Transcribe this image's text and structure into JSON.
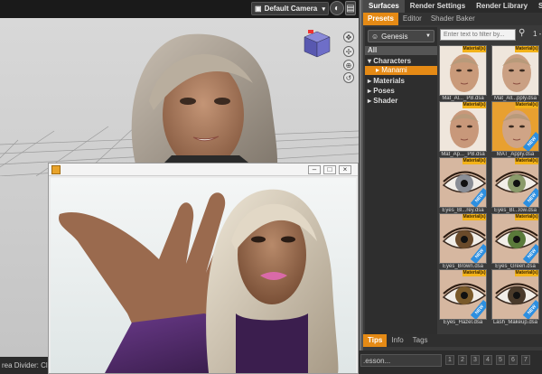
{
  "viewport": {
    "camera_label": "Default Camera"
  },
  "statusbar": {
    "text": "rea Divider: Click and drag to resize"
  },
  "lesson": {
    "select_text": ".esson...",
    "numbers": [
      "1",
      "2",
      "3",
      "4",
      "5",
      "6",
      "7"
    ]
  },
  "panel": {
    "tabs": [
      "Surfaces",
      "Render Settings",
      "Render Library",
      "Scene"
    ],
    "sub_tabs": [
      "Presets",
      "Editor",
      "Shader Baker"
    ],
    "figure_select": "Genesis",
    "tree": {
      "all": "All",
      "characters": "Characters",
      "manami": "Manami",
      "materials": "Materials",
      "poses": "Poses",
      "shader": "Shader"
    },
    "search_placeholder": "Enter text to filter by...",
    "pager": "1 -",
    "thumbs": [
      {
        "label": "Mat_Al..._PB.dsa",
        "tag": "Material(s)"
      },
      {
        "label": "Mat_All...pply.dsa",
        "tag": "Material(s)"
      },
      {
        "label": "Mat_Ap..._PB.dsa",
        "tag": "Material(s)"
      },
      {
        "label": "MAT_Apply.dsa",
        "tag": "Material(s)",
        "new": "NEW"
      },
      {
        "label": "Eyes_Bl...rey.dsa",
        "tag": "Material(s)",
        "new": "NEW"
      },
      {
        "label": "Eyes_Bl...low.dsa",
        "tag": "Material(s)",
        "new": "NEW"
      },
      {
        "label": "Eyes_Brown.dsa",
        "tag": "Material(s)",
        "new": "NEW"
      },
      {
        "label": "Eyes_Green.dsa",
        "tag": "Material(s)",
        "new": "NEW"
      },
      {
        "label": "Eyes_Hazel.dsa",
        "tag": "Material(s)",
        "new": "NEW"
      },
      {
        "label": "Lash_Makeup.dsa",
        "tag": "Material(s)",
        "new": "NEW"
      }
    ],
    "bottom_tabs": [
      "Tips",
      "Info",
      "Tags"
    ]
  },
  "colors": {
    "accent": "#e58a15",
    "material_tag": "#f3b218",
    "new_tag": "#2d8fe0"
  }
}
